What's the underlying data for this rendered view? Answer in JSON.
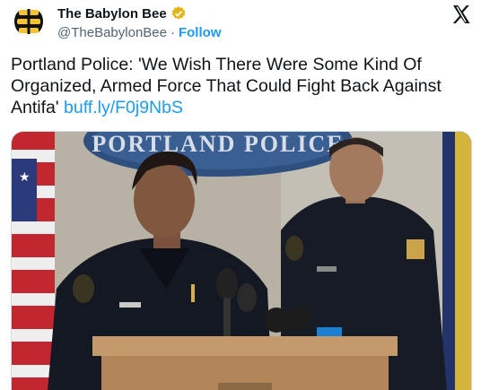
{
  "account": {
    "name": "The Babylon Bee",
    "handle": "@TheBabylonBee",
    "separator": "·",
    "follow_label": "Follow",
    "verified": true
  },
  "tweet": {
    "text": "Portland Police: 'We Wish There Were Some Kind Of Organized, Armed Force That Could Fight Back Against Antifa' ",
    "link": "buff.ly/F0j9NbS"
  },
  "media": {
    "banner_text": "PORTLAND POLICE"
  },
  "icons": {
    "avatar": "babylon-bee-logo",
    "verified": "verified-badge-icon",
    "platform": "x-logo-icon"
  },
  "colors": {
    "accent": "#1d9bf0",
    "verified_gold": "#e2b719",
    "avatar_yellow": "#f4c430"
  }
}
